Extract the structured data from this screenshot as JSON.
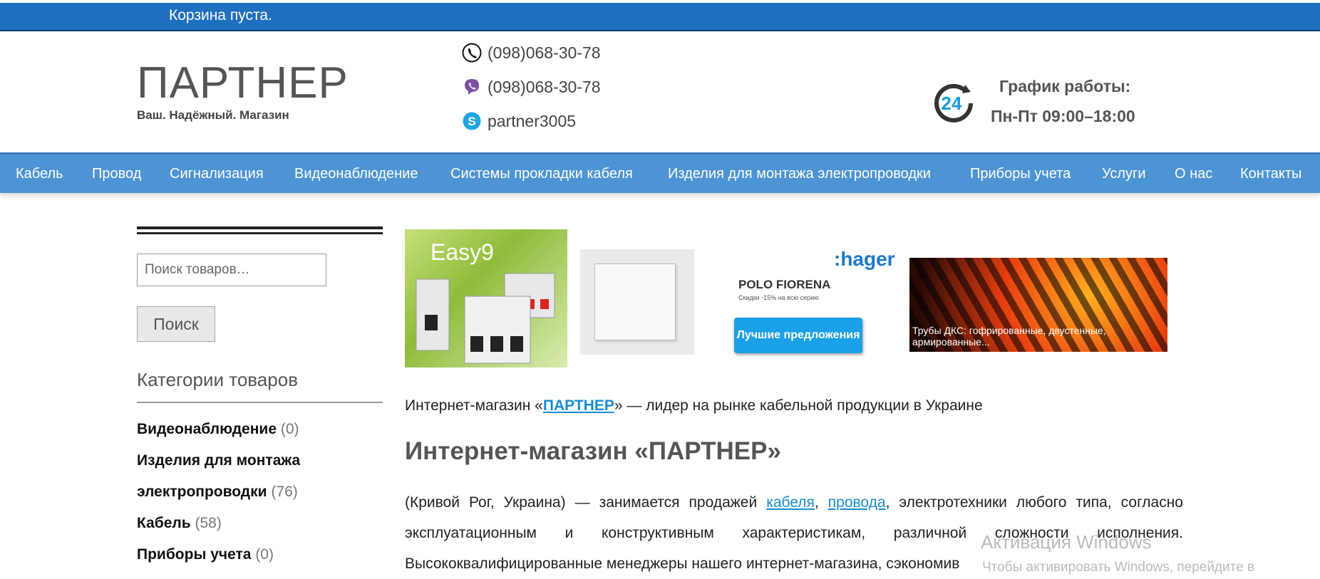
{
  "topbar": {
    "cart_text": "Корзина пуста."
  },
  "header": {
    "logo_title": "ПАРТНЕР",
    "logo_subtitle": "Ваш. Надёжный. Магазин",
    "contacts": {
      "phone": "(098)068-30-78",
      "viber": "(098)068-30-78",
      "skype": "partner3005"
    },
    "schedule_title": "График работы:",
    "schedule_hours": "Пн-Пт 09:00–18:00",
    "clock_badge": "24"
  },
  "nav": {
    "items": [
      "Кабель",
      "Провод",
      "Сигнализация",
      "Видеонаблюдение",
      "Системы прокладки кабеля",
      "Изделия для монтажа электропроводки",
      "Приборы учета",
      "Услуги",
      "О нас",
      "Контакты"
    ]
  },
  "sidebar": {
    "search_placeholder": "Поиск товаров…",
    "search_button": "Поиск",
    "categories_title": "Категории товаров",
    "categories": [
      {
        "name": "Видеонаблюдение",
        "count": "(0)"
      },
      {
        "name": "Изделия для монтажа",
        "name2": "электропроводки",
        "count": "(76)"
      },
      {
        "name": "Кабель",
        "count": "(58)"
      },
      {
        "name": "Приборы учета",
        "count": "(0)"
      }
    ]
  },
  "banners": {
    "b1_title": "Easy9",
    "b3_brand": ":hager",
    "b3_product": "POLO FIORENA",
    "b3_discount": "Скидки -15% на всю серию",
    "b3_cta": "Лучшие предложения",
    "b4_caption": "Трубы ДКС: гофрированные, двустенные, армированные..."
  },
  "main": {
    "intro_before": "Интернет-магазин «",
    "intro_link": "ПАРТНЕР",
    "intro_after": "» — лидер на рынке кабельной продукции в Украине",
    "heading": "Интернет-магазин «ПАРТНЕР»",
    "para_start": "(Кривой Рог, Украина) — занимается продажей ",
    "link_cable": "кабеля",
    "sep": ", ",
    "link_wire": "провода",
    "para_rest": ", электротехники любого типа, согласно эксплуатационным и конструктивным характеристикам, различной сложности исполнения. Высококвалифицированные менеджеры нашего интернет-магазина, сэкономив"
  },
  "watermark": {
    "line1": "Активация Windows",
    "line2": "Чтобы активировать Windows, перейдите в"
  },
  "colors": {
    "topbar": "#1e6fbf",
    "nav": "#4c94d3",
    "link": "#1a8ccf"
  }
}
